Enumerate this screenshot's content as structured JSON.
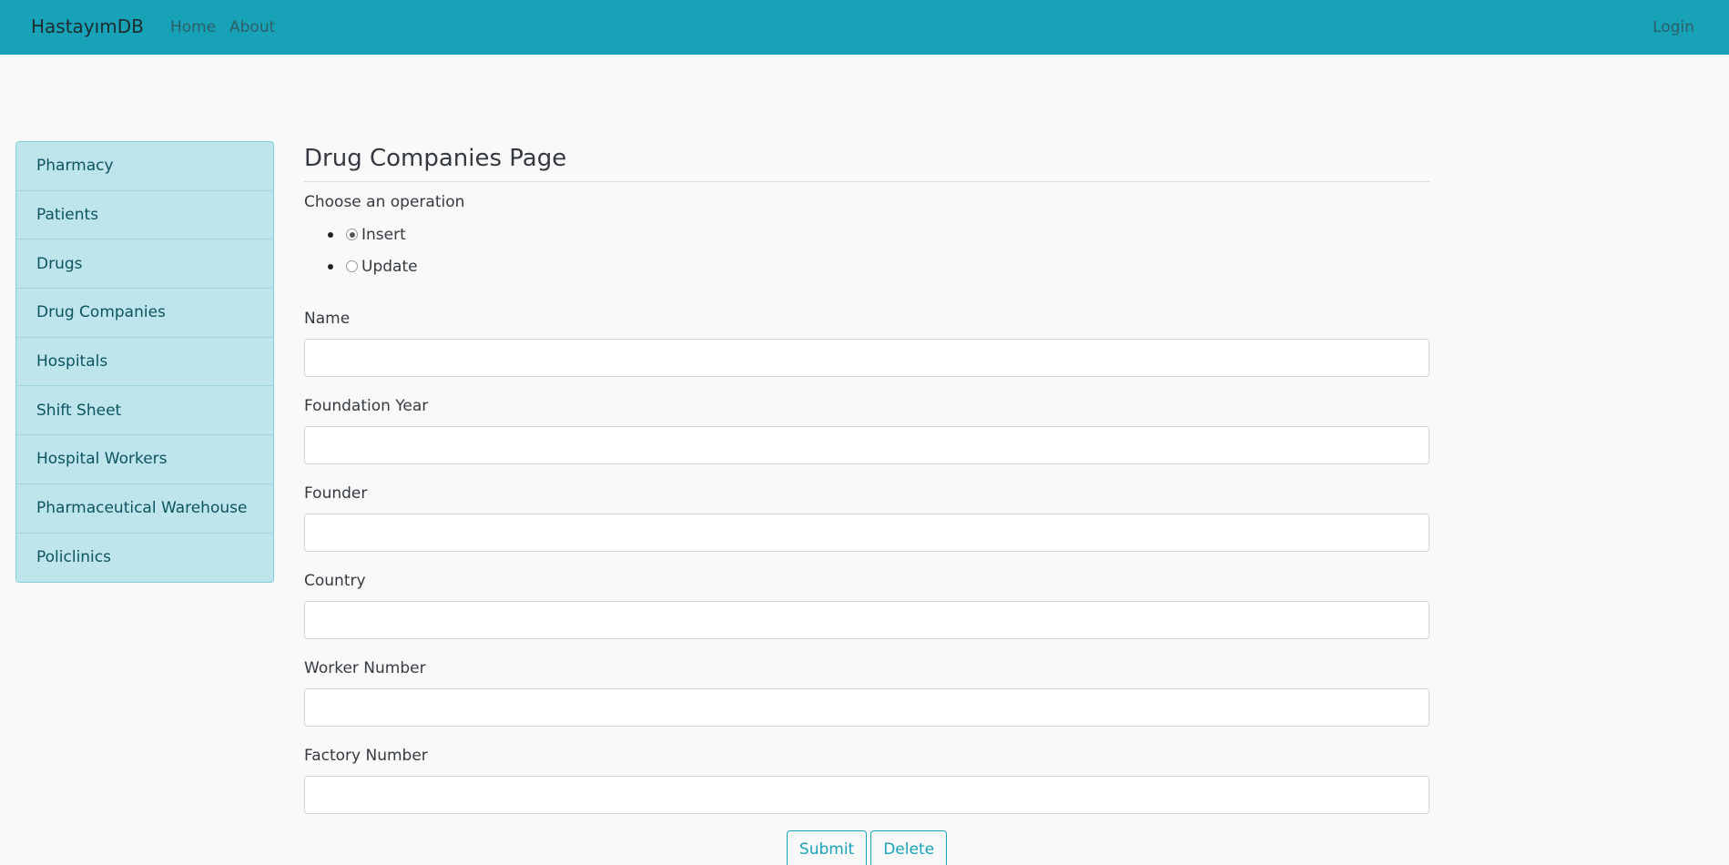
{
  "navbar": {
    "brand": "HastayımDB",
    "links": [
      "Home",
      "About"
    ],
    "login": "Login",
    "color": "#17a2b8"
  },
  "sidebar": {
    "items": [
      {
        "label": "Pharmacy"
      },
      {
        "label": "Patients"
      },
      {
        "label": "Drugs"
      },
      {
        "label": "Drug Companies"
      },
      {
        "label": "Hospitals"
      },
      {
        "label": "Shift Sheet"
      },
      {
        "label": "Hospital Workers"
      },
      {
        "label": "Pharmaceutical Warehouse"
      },
      {
        "label": "Policlinics"
      }
    ]
  },
  "main": {
    "title": "Drug Companies Page",
    "operation_label": "Choose an operation",
    "operations": [
      {
        "label": "Insert",
        "selected": true
      },
      {
        "label": "Update",
        "selected": false
      }
    ],
    "fields": [
      {
        "label": "Name",
        "value": ""
      },
      {
        "label": "Foundation Year",
        "value": ""
      },
      {
        "label": "Founder",
        "value": ""
      },
      {
        "label": "Country",
        "value": ""
      },
      {
        "label": "Worker Number",
        "value": ""
      },
      {
        "label": "Factory Number",
        "value": ""
      }
    ],
    "submit_label": "Submit",
    "delete_label": "Delete"
  }
}
